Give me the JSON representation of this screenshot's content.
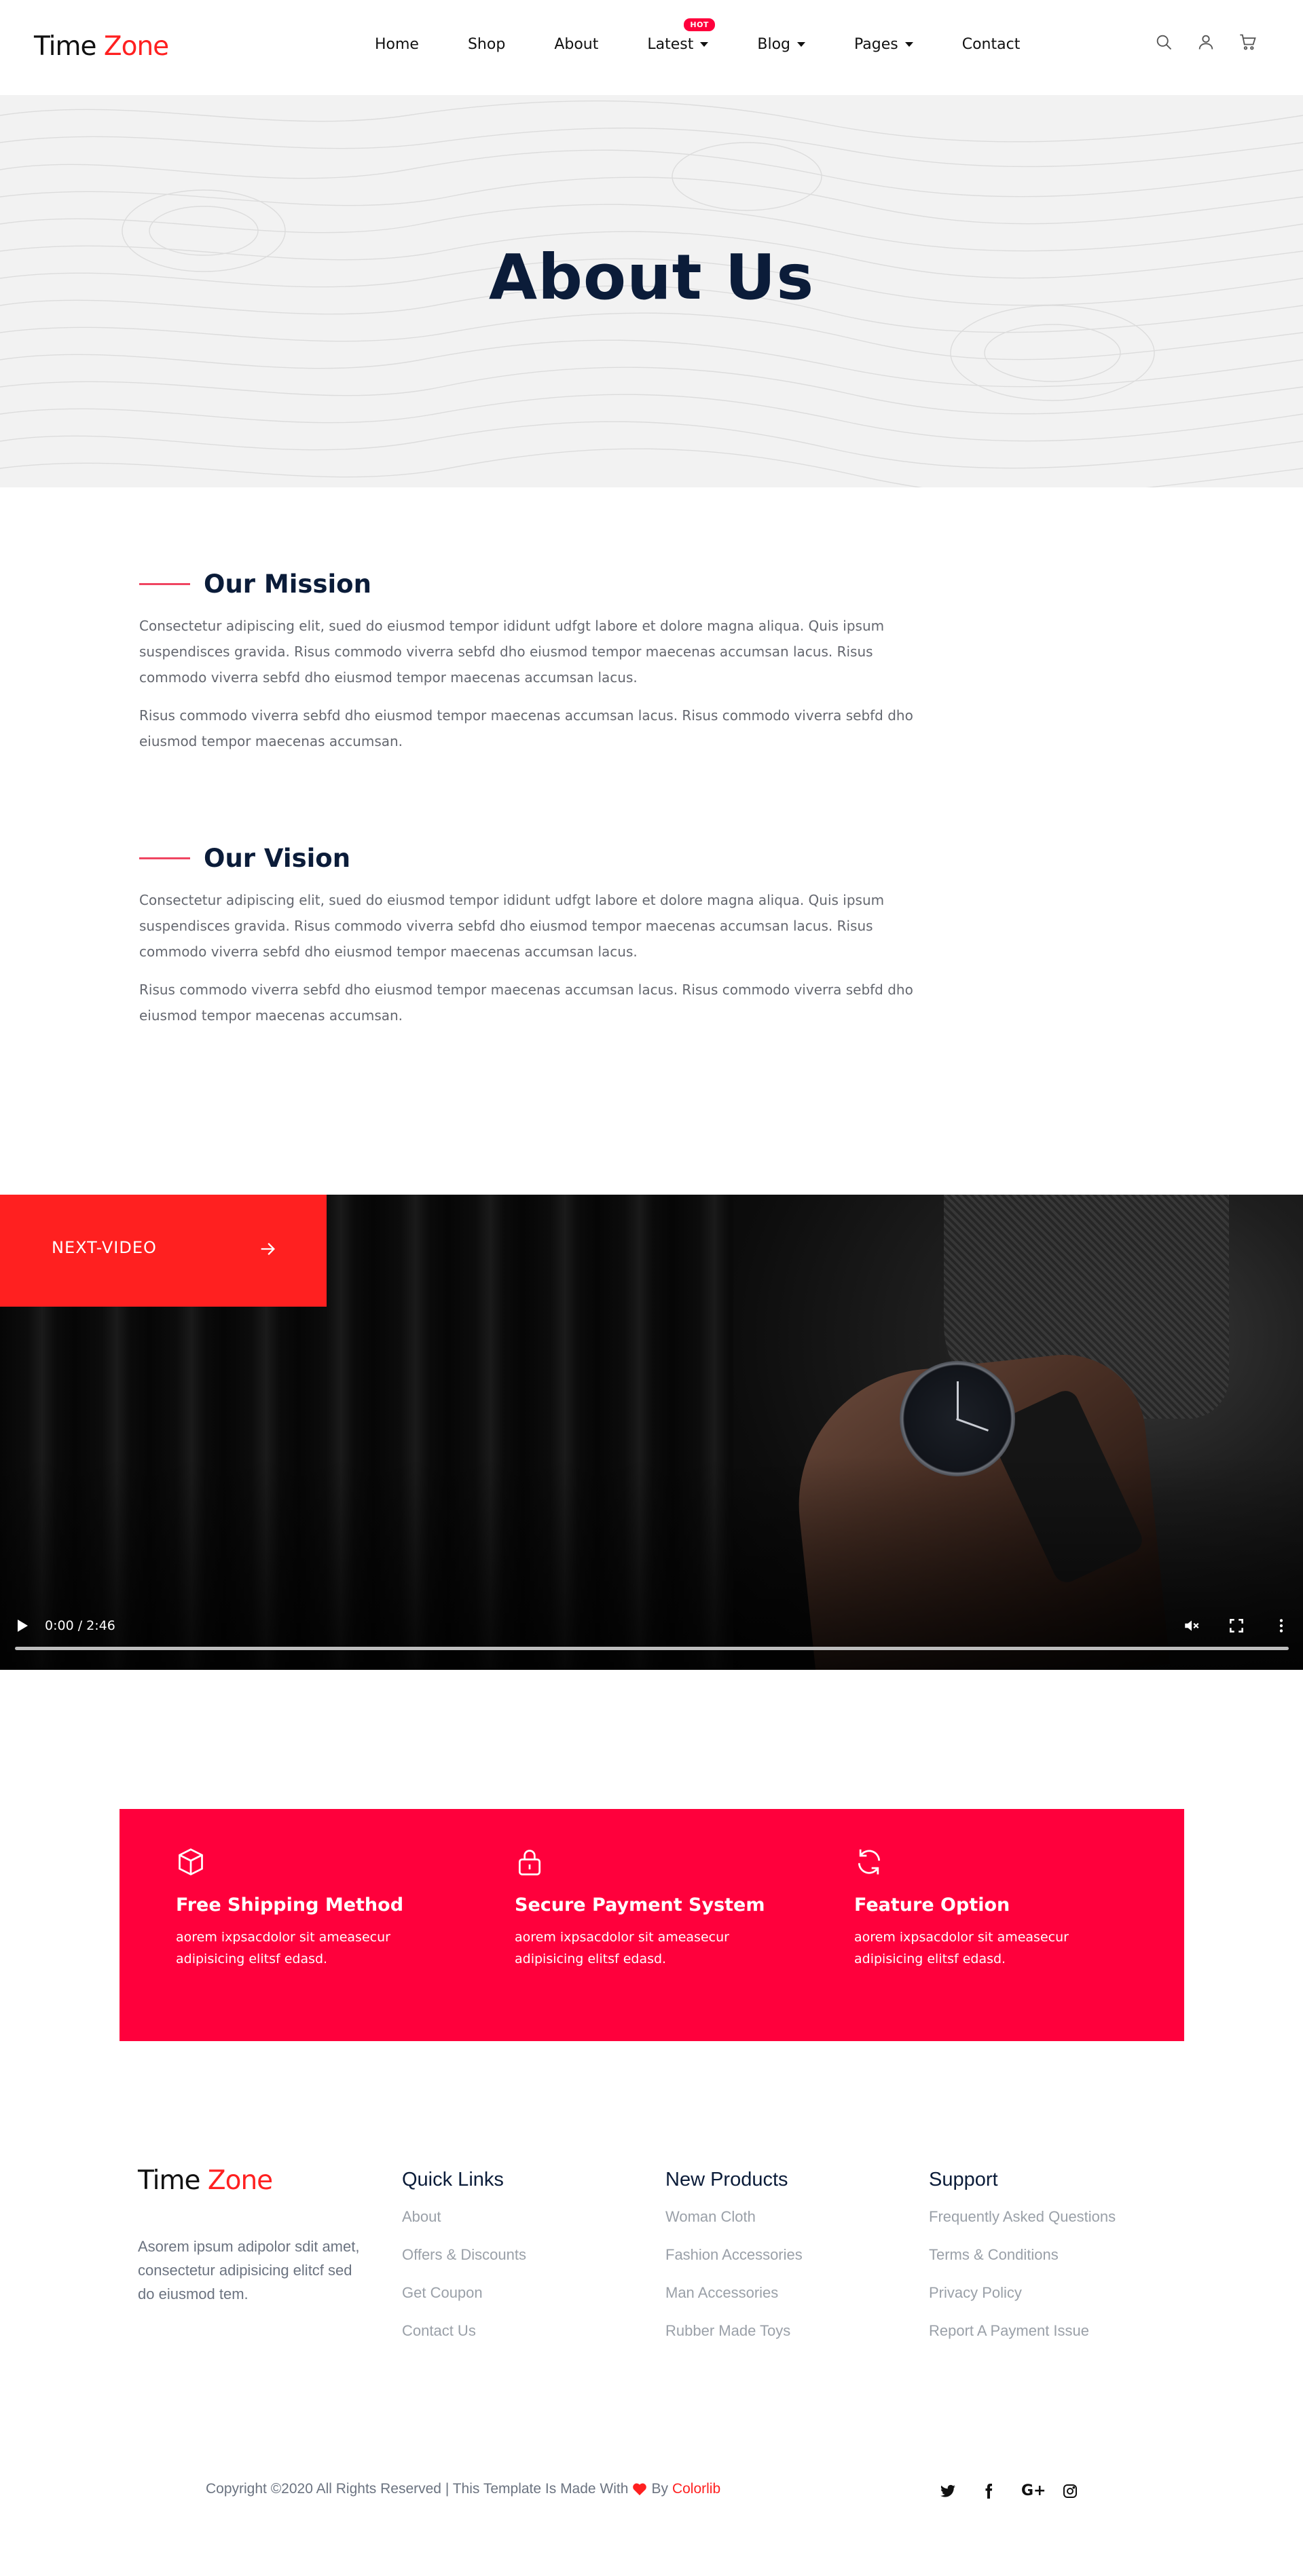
{
  "brand": {
    "logo_part1": "Time",
    "logo_part2": "Zone"
  },
  "nav": {
    "items": [
      {
        "label": "Home"
      },
      {
        "label": "Shop"
      },
      {
        "label": "About"
      },
      {
        "label": "Latest",
        "badge": "HOT"
      },
      {
        "label": "Blog"
      },
      {
        "label": "Pages"
      },
      {
        "label": "Contact"
      }
    ],
    "icons": [
      "search-icon",
      "user-icon",
      "cart-icon"
    ]
  },
  "hero": {
    "title": "About Us"
  },
  "mission": {
    "title": "Our Mission",
    "p1": "Consectetur adipiscing elit, sued do eiusmod tempor ididunt udfgt labore et dolore magna aliqua. Quis ipsum suspendisces gravida. Risus commodo viverra sebfd dho eiusmod tempor maecenas accumsan lacus. Risus commodo viverra sebfd dho eiusmod tempor maecenas accumsan lacus.",
    "p2": "Risus commodo viverra sebfd dho eiusmod tempor maecenas accumsan lacus. Risus commodo viverra sebfd dho eiusmod tempor maecenas accumsan."
  },
  "vision": {
    "title": "Our Vision",
    "p1": "Consectetur adipiscing elit, sued do eiusmod tempor ididunt udfgt labore et dolore magna aliqua. Quis ipsum suspendisces gravida. Risus commodo viverra sebfd dho eiusmod tempor maecenas accumsan lacus. Risus commodo viverra sebfd dho eiusmod tempor maecenas accumsan lacus.",
    "p2": "Risus commodo viverra sebfd dho eiusmod tempor maecenas accumsan lacus. Risus commodo viverra sebfd dho eiusmod tempor maecenas accumsan."
  },
  "video": {
    "next_label": "NEXT-VIDEO",
    "time": "0:00 / 2:46",
    "progress": 0,
    "muted": true
  },
  "features": [
    {
      "icon": "box-icon",
      "title": "Free Shipping Method",
      "text": "aorem ixpsacdolor sit ameasecur adipisicing elitsf edasd."
    },
    {
      "icon": "lock-icon",
      "title": "Secure Payment System",
      "text": "aorem ixpsacdolor sit ameasecur adipisicing elitsf edasd."
    },
    {
      "icon": "refresh-icon",
      "title": "Feature Option",
      "text": "aorem ixpsacdolor sit ameasecur adipisicing elitsf edasd."
    }
  ],
  "footer": {
    "about": "Asorem ipsum adipolor sdit amet, consectetur adipisicing elitcf sed do eiusmod tem.",
    "columns": [
      {
        "title": "Quick Links",
        "links": [
          "About",
          "Offers & Discounts",
          "Get Coupon",
          "Contact Us"
        ]
      },
      {
        "title": "New Products",
        "links": [
          "Woman Cloth",
          "Fashion Accessories",
          "Man Accessories",
          "Rubber Made Toys"
        ]
      },
      {
        "title": "Support",
        "links": [
          "Frequently Asked Questions",
          "Terms & Conditions",
          "Privacy Policy",
          "Report A Payment Issue"
        ]
      }
    ],
    "copyright_text": "Copyright ©2020 All Rights Reserved | This Template Is Made With",
    "by_text": "By",
    "by_link": "Colorlib",
    "socials": [
      "twitter-icon",
      "facebook-icon",
      "google-plus-icon",
      "instagram-icon"
    ],
    "google_plus_label": "G+"
  },
  "colors": {
    "accent": "#ff2020",
    "feature_bg": "#ff003c",
    "heading": "#0b1c39",
    "mission_line": "#ef4561"
  }
}
